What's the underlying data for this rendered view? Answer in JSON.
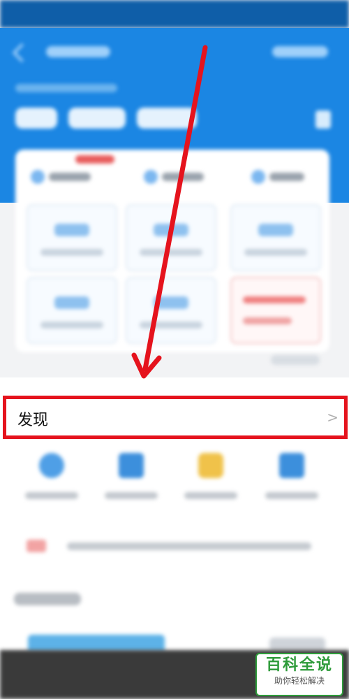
{
  "discover": {
    "label": "发现",
    "chevron": ">"
  },
  "watermark": {
    "title": "百科全说",
    "subtitle": "助你轻松解决"
  },
  "colors": {
    "header_blue": "#1b86e3",
    "highlight_red": "#e5131d",
    "watermark_green": "#2e9b3a"
  },
  "icons": [
    "back-arrow-icon",
    "menu-icon",
    "chevron-right-icon",
    "red-arrow-annotation"
  ]
}
